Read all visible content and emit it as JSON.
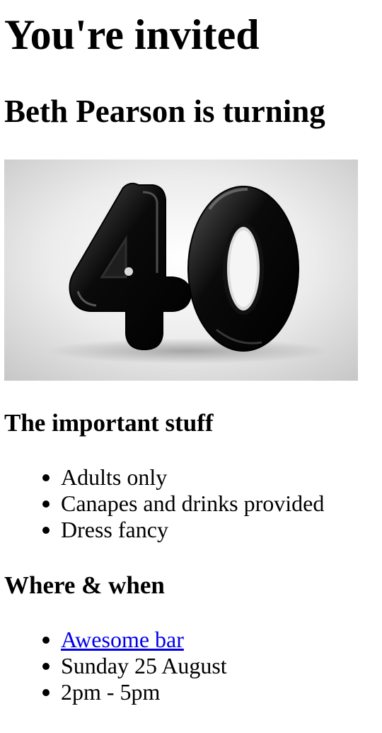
{
  "heading": {
    "title": "You're invited",
    "subtitle": "Beth Pearson is turning"
  },
  "hero_image": {
    "depicted_text": "40",
    "icon": "balloon-number-40-image"
  },
  "important": {
    "heading": "The important stuff",
    "items": [
      "Adults only",
      "Canapes and drinks provided",
      "Dress fancy"
    ]
  },
  "where_when": {
    "heading": "Where & when",
    "venue_link": "Awesome bar",
    "date": "Sunday 25 August",
    "time": "2pm - 5pm"
  },
  "colors": {
    "link": "#0000ee",
    "text": "#000000",
    "background": "#ffffff"
  }
}
